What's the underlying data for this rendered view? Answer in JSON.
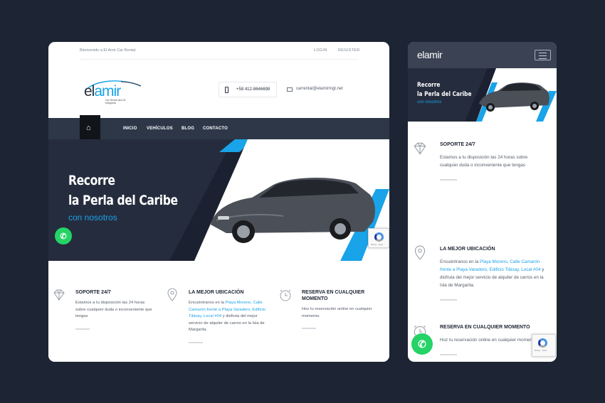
{
  "desktop": {
    "topbar": {
      "welcome": "Bienvenido a El Amir Car Rental",
      "login": "LOGIN",
      "register": "REGISTER"
    },
    "logo": {
      "word_a": "el",
      "word_b": "amir",
      "tagline": "Car Rental Isla De Margarita"
    },
    "contact": {
      "phone": "+58 412-8646698",
      "email": "carrental@elamirmgt.net"
    },
    "nav": {
      "items": [
        "INICIO",
        "VEHÍCULOS",
        "BLOG",
        "CONTACTO"
      ]
    },
    "hero": {
      "title_line1": "Recorre",
      "title_line2": "la Perla del Caribe",
      "subtitle": "con nosotros"
    },
    "features": [
      {
        "title": "SOPORTE 24/7",
        "text": "Estamos a tu disposición las 24 horas sobre cualquier duda o inconveniente que tengas"
      },
      {
        "title": "LA MEJOR UBICACIÓN",
        "text_pre": "Encuéntranos en la ",
        "text_link": "Playa Moreno, Calle Camarón frente a Playa Varadero, Edificio Tibisay, Local #04",
        "text_post": " y disfruta del mejor servicio de alquiler de carros en la Isla de Margarita."
      },
      {
        "title": "RESERVA EN CUALQUIER MOMENTO",
        "text": "Hoz tu reservación online en cualquier momento."
      }
    ]
  },
  "mobile": {
    "logo": "elamir",
    "hero": {
      "title_line1": "Recorre",
      "title_line2": "la Perla del Caribe",
      "subtitle": "con nosotros"
    },
    "features": [
      {
        "title": "SOPORTE 24/7",
        "text": "Estamos a tu disposición las 24 horas sobre cualquier duda o inconveniente que tengas"
      },
      {
        "title": "LA MEJOR UBICACIÓN",
        "text_pre": "Encuéntranos en la ",
        "text_link": "Playa Moreno, Calle Camarón frente a Playa Varadero, Edificio Tibisay, Local #04",
        "text_post": " y disfruta del mejor servicio de alquiler de carros en la Isla de Margarita."
      },
      {
        "title": "RESERVA EN CUALQUIER MOMENTO",
        "text": "Hoz tu reservación online en cualquier momento."
      }
    ]
  },
  "icons": {
    "whatsapp": "whatsapp-icon",
    "home": "home-icon",
    "phone": "phone-icon",
    "mail": "mail-icon",
    "diamond": "diamond-icon",
    "location": "location-pin-icon",
    "clock": "clock-icon",
    "recaptcha": "recaptcha-icon"
  },
  "colors": {
    "background": "#1d2433",
    "navbar": "#2d3748",
    "hero": "#252c3d",
    "accent": "#19a3e8",
    "whatsapp": "#25d366"
  }
}
